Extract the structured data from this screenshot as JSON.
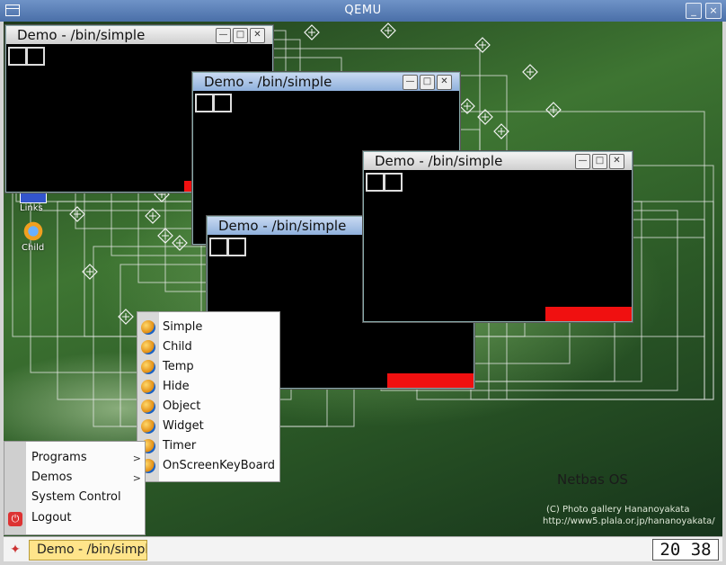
{
  "host": {
    "title": "QEMU",
    "minimize": "_",
    "close": "×"
  },
  "windows": [
    {
      "title": "Demo - /bin/simple",
      "state": "inactive"
    },
    {
      "title": "Demo - /bin/simple",
      "state": "active"
    },
    {
      "title": "Demo - /bin/simple",
      "state": "inactive"
    },
    {
      "title": "Demo - /bin/simple",
      "state": "active"
    }
  ],
  "window_buttons": {
    "minimize": "—",
    "maximize": "□",
    "close": "✕"
  },
  "desktop_icons": [
    {
      "label": "Links",
      "icon": "links-icon"
    },
    {
      "label": "Child",
      "icon": "gear-icon"
    }
  ],
  "submenu": {
    "items": [
      "Simple",
      "Child",
      "Temp",
      "Hide",
      "Object",
      "Widget",
      "Timer",
      "OnScreenKeyBoard"
    ]
  },
  "start_menu": {
    "items": [
      {
        "label": "Programs",
        "arrow": ">"
      },
      {
        "label": "Demos",
        "arrow": ">"
      },
      {
        "label": "System Control",
        "arrow": ""
      },
      {
        "label": "Logout",
        "arrow": ""
      }
    ]
  },
  "taskbar": {
    "task_label": "Demo - /bin/simple",
    "clock": "20 38"
  },
  "branding": {
    "os_name": "Netbas OS",
    "credit": "(C) Photo gallery Hananoyakata",
    "credit_url": "http://www5.plala.or.jp/hananoyakata/"
  },
  "colors": {
    "accent_red": "#f01010",
    "title_active": "#8fb0dc",
    "taskbar_task": "#ffe48a"
  }
}
